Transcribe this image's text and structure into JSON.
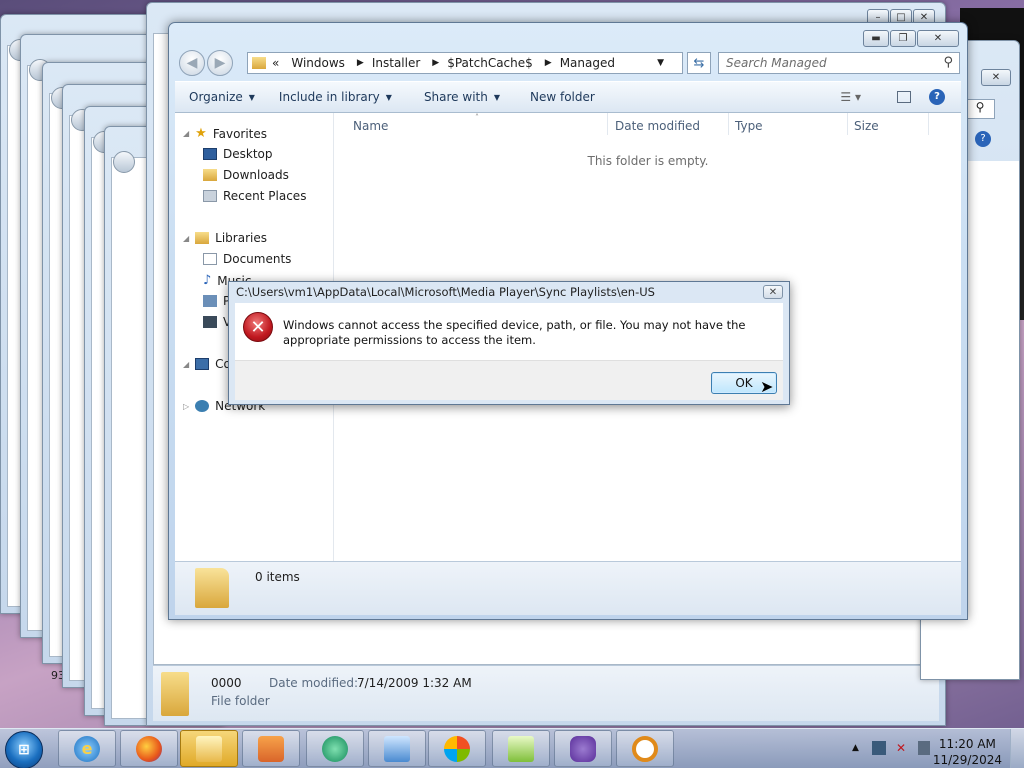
{
  "explorer": {
    "address_root": "«",
    "breadcrumbs": [
      "Windows",
      "Installer",
      "$PatchCache$",
      "Managed"
    ],
    "search_placeholder": "Search Managed",
    "commands": {
      "organize": "Organize",
      "include_in_library": "Include in library",
      "share_with": "Share with",
      "new_folder": "New folder"
    },
    "nav": {
      "favorites": "Favorites",
      "desktop": "Desktop",
      "downloads": "Downloads",
      "recent_places": "Recent Places",
      "libraries": "Libraries",
      "documents": "Documents",
      "music": "Music",
      "pictures_partial": "P",
      "videos_partial": "V",
      "computer_partial": "Co",
      "network": "Network"
    },
    "columns": {
      "name": "Name",
      "date_modified": "Date modified",
      "type": "Type",
      "size": "Size"
    },
    "empty_message": "This folder is empty.",
    "status_items": "0 items"
  },
  "background_window": {
    "item_count_partial": "936 ob",
    "selected_name": "0000",
    "date_label": "Date modified:",
    "date_value": "7/14/2009 1:32 AM",
    "item_type": "File folder"
  },
  "dialog": {
    "title": "C:\\Users\\vm1\\AppData\\Local\\Microsoft\\Media Player\\Sync Playlists\\en-US",
    "message": "Windows cannot access the specified device, path, or file.  You may not have the appropriate permissions to access the item.",
    "ok_label": "OK"
  },
  "taskbar": {
    "items": [
      "internet-explorer",
      "firefox",
      "windows-explorer",
      "media-player",
      "media-center",
      "remote-desktop",
      "windows-media",
      "notepad-plus-plus",
      "visual-studio",
      "search-tool"
    ],
    "time": "11:20 AM",
    "date": "11/29/2024"
  },
  "colors": {
    "accent": "#3c7fb1",
    "error": "#c0181f",
    "window_frame": "#bfd4ec"
  }
}
